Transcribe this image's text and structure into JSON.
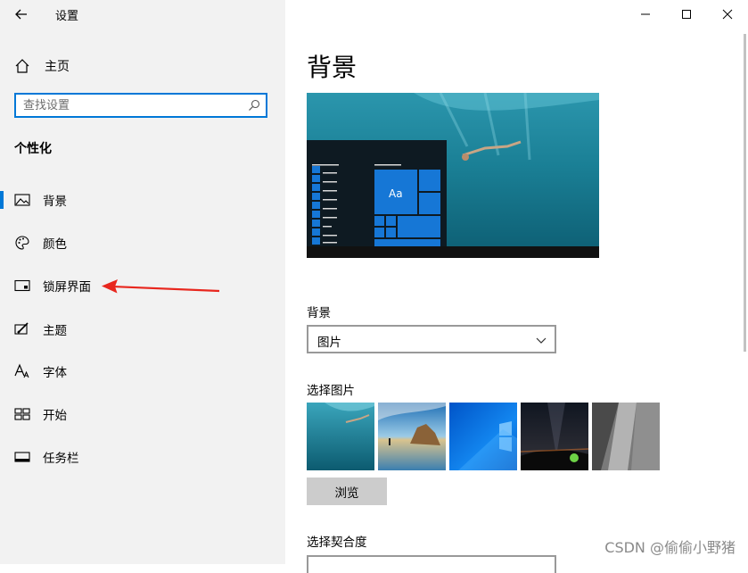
{
  "window": {
    "title": "设置",
    "controls": [
      "minimize",
      "maximize",
      "close"
    ]
  },
  "sidebar": {
    "home_label": "主页",
    "search_placeholder": "查找设置",
    "section_title": "个性化",
    "items": [
      {
        "label": "背景",
        "icon": "image-icon",
        "active": true
      },
      {
        "label": "颜色",
        "icon": "palette-icon",
        "active": false
      },
      {
        "label": "锁屏界面",
        "icon": "lock-screen-icon",
        "active": false
      },
      {
        "label": "主题",
        "icon": "theme-brush-icon",
        "active": false
      },
      {
        "label": "字体",
        "icon": "font-icon",
        "active": false
      },
      {
        "label": "开始",
        "icon": "start-tiles-icon",
        "active": false
      },
      {
        "label": "任务栏",
        "icon": "taskbar-icon",
        "active": false
      }
    ]
  },
  "annotation": {
    "arrow_color": "#e8271e"
  },
  "main": {
    "page_title": "背景",
    "preview_tile_label": "Aa",
    "background_label": "背景",
    "background_value": "图片",
    "choose_picture_label": "选择图片",
    "browse_label": "浏览",
    "fit_label": "选择契合度"
  },
  "colors": {
    "accent": "#0078d7",
    "sidebar_bg": "#f2f2f2",
    "button_bg": "#cccccc"
  },
  "watermark": "CSDN @偷偷小野猪"
}
